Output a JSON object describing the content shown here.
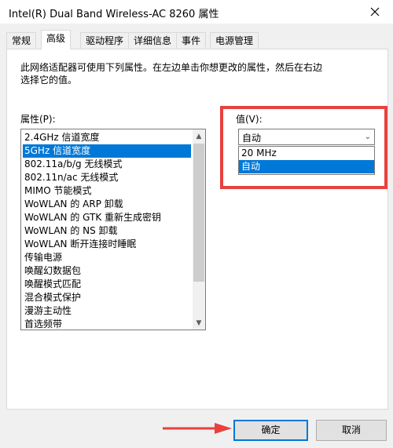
{
  "window": {
    "title": "Intel(R) Dual Band Wireless-AC 8260 属性"
  },
  "tabs": [
    {
      "label": "常规"
    },
    {
      "label": "高级"
    },
    {
      "label": "驱动程序"
    },
    {
      "label": "详细信息"
    },
    {
      "label": "事件"
    },
    {
      "label": "电源管理"
    }
  ],
  "active_tab": "高级",
  "panel": {
    "description_line1": "此网络适配器可使用下列属性。在左边单击你想更改的属性，然后在右边",
    "description_line2": "选择它的值。",
    "property_label": "属性(P):",
    "value_label": "值(V):"
  },
  "properties": [
    {
      "label": "2.4GHz 信道宽度"
    },
    {
      "label": "5GHz 信道宽度"
    },
    {
      "label": "802.11a/b/g 无线模式"
    },
    {
      "label": "802.11n/ac 无线模式"
    },
    {
      "label": "MIMO 节能模式"
    },
    {
      "label": "WoWLAN 的 ARP 卸载"
    },
    {
      "label": "WoWLAN 的 GTK 重新生成密钥"
    },
    {
      "label": "WoWLAN 的 NS 卸载"
    },
    {
      "label": "WoWLAN 断开连接时睡眠"
    },
    {
      "label": "传输电源"
    },
    {
      "label": "唤醒幻数据包"
    },
    {
      "label": "唤醒模式匹配"
    },
    {
      "label": "混合模式保护"
    },
    {
      "label": "漫游主动性"
    },
    {
      "label": "首选频带"
    }
  ],
  "selected_property": "5GHz 信道宽度",
  "value_combo": {
    "current": "自动",
    "options": [
      {
        "label": "20 MHz"
      },
      {
        "label": "自动"
      }
    ],
    "highlighted": "自动"
  },
  "buttons": {
    "ok": "确定",
    "cancel": "取消"
  },
  "colors": {
    "selection": "#0078d7",
    "annotation_red": "#e8413e",
    "default_button_border": "#0078d7"
  }
}
